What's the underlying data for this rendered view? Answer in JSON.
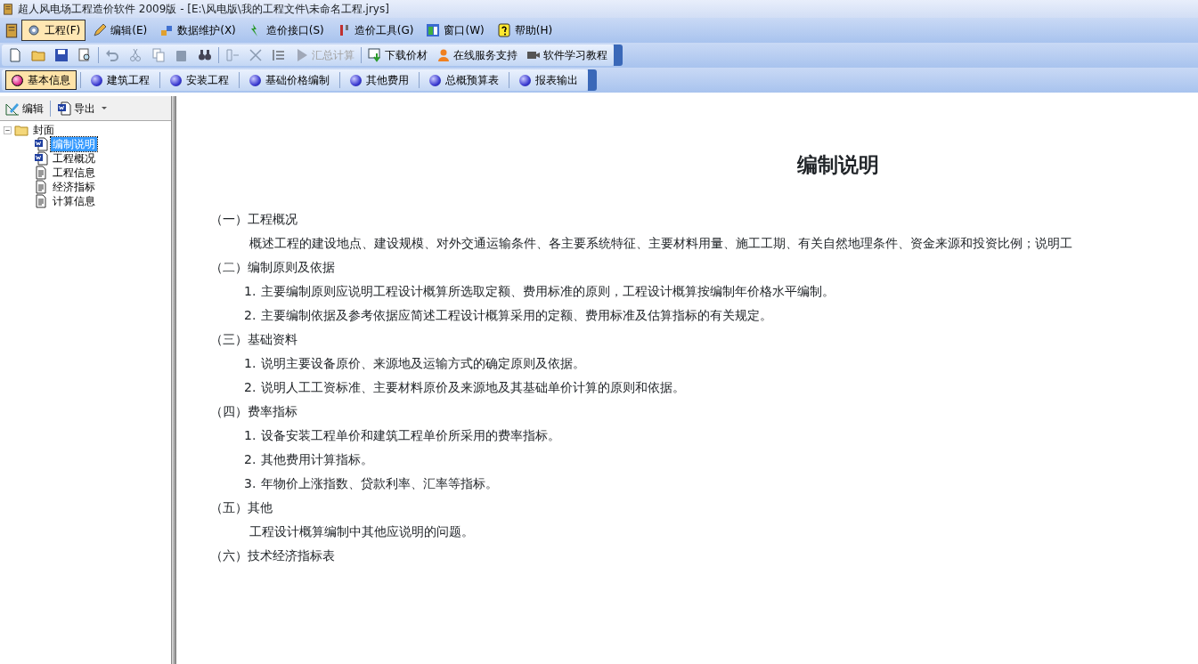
{
  "window": {
    "title": "超人风电场工程造价软件 2009版 - [E:\\风电版\\我的工程文件\\未命名工程.jrys]"
  },
  "menu": [
    {
      "label": "工程(F)",
      "selected": true
    },
    {
      "label": "编辑(E)",
      "selected": false
    },
    {
      "label": "数据维护(X)",
      "selected": false
    },
    {
      "label": "造价接口(S)",
      "selected": false
    },
    {
      "label": "造价工具(G)",
      "selected": false
    },
    {
      "label": "窗口(W)",
      "selected": false
    },
    {
      "label": "帮助(H)",
      "selected": false
    }
  ],
  "toolbar": [
    {
      "label": "汇总计算",
      "disabled": true
    },
    {
      "label": "下载价材",
      "disabled": false
    },
    {
      "label": "在线服务支持",
      "disabled": false
    },
    {
      "label": "软件学习教程",
      "disabled": false
    }
  ],
  "modules": [
    {
      "label": "基本信息",
      "selected": true
    },
    {
      "label": "建筑工程",
      "selected": false
    },
    {
      "label": "安装工程",
      "selected": false
    },
    {
      "label": "基础价格编制",
      "selected": false
    },
    {
      "label": "其他费用",
      "selected": false
    },
    {
      "label": "总概预算表",
      "selected": false
    },
    {
      "label": "报表输出",
      "selected": false
    }
  ],
  "sub_toolbar": [
    "编辑",
    "导出"
  ],
  "tree": [
    {
      "label": "封面",
      "kind": "folder",
      "expanded": true,
      "selected": false,
      "children": [
        {
          "label": "编制说明",
          "kind": "word",
          "selected": true
        },
        {
          "label": "工程概况",
          "kind": "word",
          "selected": false
        },
        {
          "label": "工程信息",
          "kind": "text",
          "selected": false
        },
        {
          "label": "经济指标",
          "kind": "text",
          "selected": false
        },
        {
          "label": "计算信息",
          "kind": "text",
          "selected": false
        }
      ]
    }
  ],
  "document": {
    "title": "编制说明",
    "sections": [
      {
        "heading": "（一）工程概况",
        "paragraphs": [
          "概述工程的建设地点、建设规模、对外交通运输条件、各主要系统特征、主要材料用量、施工工期、有关自然地理条件、资金来源和投资比例；说明工"
        ]
      },
      {
        "heading": "（二）编制原则及依据",
        "items": [
          {
            "number": "1.",
            "text": "主要编制原则应说明工程设计概算所选取定额、费用标准的原则，工程设计概算按编制年价格水平编制。"
          },
          {
            "number": "2.",
            "text": "主要编制依据及参考依据应简述工程设计概算采用的定额、费用标准及估算指标的有关规定。"
          }
        ]
      },
      {
        "heading": "（三）基础资料",
        "items": [
          {
            "number": "1.",
            "text": "说明主要设备原价、来源地及运输方式的确定原则及依据。"
          },
          {
            "number": "2.",
            "text": "说明人工工资标准、主要材料原价及来源地及其基础单价计算的原则和依据。"
          }
        ]
      },
      {
        "heading": "（四）费率指标",
        "items": [
          {
            "number": "1.",
            "text": "设备安装工程单价和建筑工程单价所采用的费率指标。"
          },
          {
            "number": "2.",
            "text": "其他费用计算指标。"
          },
          {
            "number": "3.",
            "text": "年物价上涨指数、贷款利率、汇率等指标。"
          }
        ]
      },
      {
        "heading": "（五）其他",
        "paragraphs": [
          "工程设计概算编制中其他应说明的问题。"
        ]
      },
      {
        "heading": "（六）技术经济指标表"
      }
    ]
  }
}
